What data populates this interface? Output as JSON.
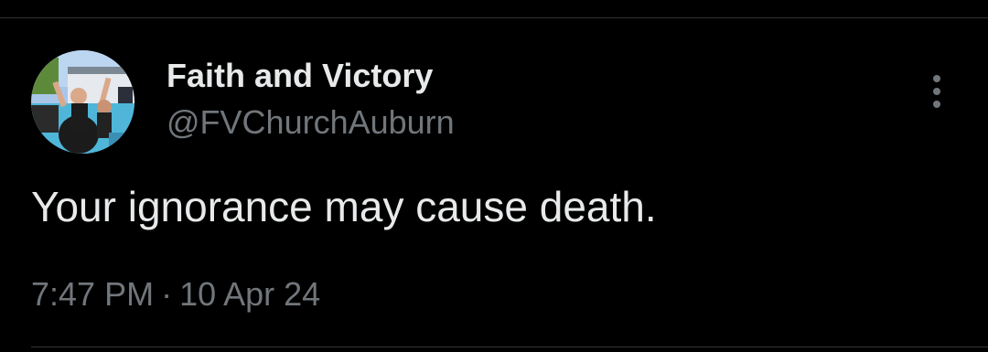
{
  "author": {
    "display_name": "Faith and Victory",
    "handle": "@FVChurchAuburn",
    "avatar_description_icon": "avatar-photo"
  },
  "tweet": {
    "text": "Your ignorance may cause death.",
    "time": "7:47 PM",
    "separator": "·",
    "date": "10 Apr 24"
  },
  "icons": {
    "more": "more-vertical-icon"
  },
  "colors": {
    "background": "#000000",
    "primary_text": "#e7e9ea",
    "secondary_text": "#71767b",
    "divider": "#2f3336"
  }
}
